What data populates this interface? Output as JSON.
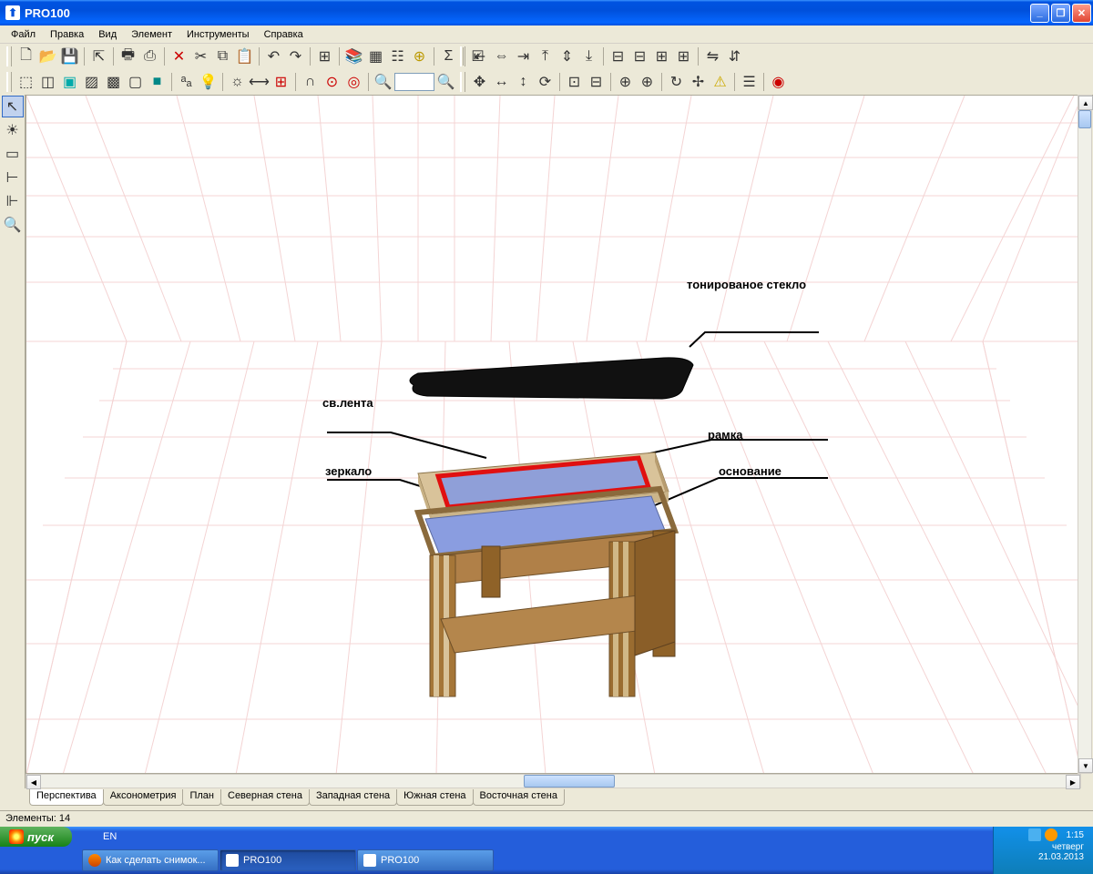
{
  "window": {
    "title": "PRO100"
  },
  "menu": {
    "file": "Файл",
    "edit": "Правка",
    "view": "Вид",
    "element": "Элемент",
    "tools": "Инструменты",
    "help": "Справка"
  },
  "viewTabs": {
    "perspective": "Перспектива",
    "axonometry": "Аксонометрия",
    "plan": "План",
    "north": "Северная стена",
    "west": "Западная стена",
    "south": "Южная стена",
    "east": "Восточная стена"
  },
  "annotations": {
    "tintedGlass": "тонированое стекло",
    "ledStrip": "св.лента",
    "frame": "рамка",
    "mirror": "зеркало",
    "base": "основание"
  },
  "status": {
    "elements": "Элементы: 14"
  },
  "taskbar": {
    "start": "пуск",
    "lang": "EN",
    "task1": "Как сделать снимок...",
    "task2": "PRO100",
    "task3": "PRO100",
    "time": "1:15",
    "day": "четверг",
    "date": "21.03.2013"
  }
}
